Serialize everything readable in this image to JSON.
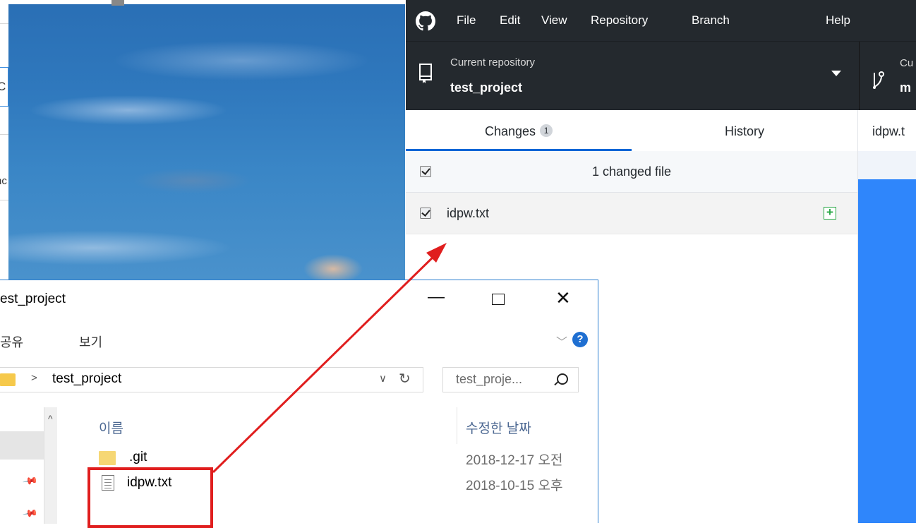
{
  "github_desktop": {
    "menu": [
      "File",
      "Edit",
      "View",
      "Repository",
      "Branch",
      "Help"
    ],
    "repository": {
      "caption": "Current repository",
      "name": "test_project"
    },
    "branch": {
      "caption": "Cu",
      "name": "m"
    },
    "tabs": {
      "changes": "Changes",
      "changes_count": "1",
      "history": "History"
    },
    "changed_header": "1 changed file",
    "files": [
      {
        "name": "idpw.txt",
        "status": "added"
      }
    ],
    "diff_tab": "idpw.t"
  },
  "explorer": {
    "title": "est_project",
    "ribbon_tabs": [
      "공유",
      "보기"
    ],
    "address": "test_project",
    "search_placeholder": "test_proje...",
    "columns": {
      "name": "이름",
      "date": "수정한 날짜"
    },
    "rows": [
      {
        "name": ".git",
        "date": "2018-12-17 오전"
      },
      {
        "name": "idpw.txt",
        "date": "2018-10-15 오후"
      }
    ]
  },
  "background": {
    "partial_text_1": "C",
    "partial_text_2": "nc"
  },
  "colors": {
    "accent": "#0366d6",
    "highlight": "#e01e1e",
    "diff_blue": "#2f86fb",
    "toolbar": "#24292e"
  }
}
